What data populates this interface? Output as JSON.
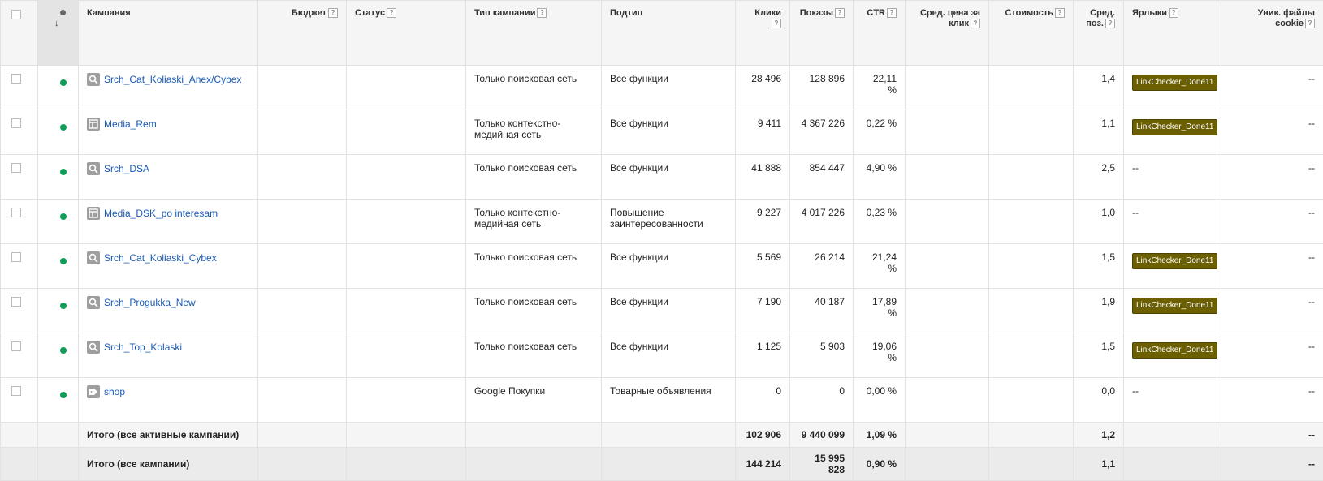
{
  "columns": {
    "campaign": "Кампания",
    "budget": "Бюджет",
    "status": "Статус",
    "type": "Тип кампании",
    "subtype": "Подтип",
    "clicks": "Клики",
    "impressions": "Показы",
    "ctr": "CTR",
    "avg_cpc": "Сред. цена за клик",
    "cost": "Стоимость",
    "avg_pos": "Сред. поз.",
    "labels": "Ярлыки",
    "unique_cookies": "Уник. файлы cookie"
  },
  "help_mark": "?",
  "sort_arrow": "↓",
  "rows": [
    {
      "icon": "search-icon",
      "name": "Srch_Cat_Koliaski_Anex/Cybex",
      "type": "Только поисковая сеть",
      "subtype": "Все функции",
      "clicks": "28 496",
      "impressions": "128 896",
      "ctr": "22,11 %",
      "avg_pos": "1,4",
      "label": "LinkChecker_Done11",
      "cookies": "--"
    },
    {
      "icon": "display-icon",
      "name": "Media_Rem",
      "type": "Только контекстно-медийная сеть",
      "subtype": "Все функции",
      "clicks": "9 411",
      "impressions": "4 367 226",
      "ctr": "0,22 %",
      "avg_pos": "1,1",
      "label": "LinkChecker_Done11",
      "cookies": "--"
    },
    {
      "icon": "search-icon",
      "name": "Srch_DSA",
      "type": "Только поисковая сеть",
      "subtype": "Все функции",
      "clicks": "41 888",
      "impressions": "854 447",
      "ctr": "4,90 %",
      "avg_pos": "2,5",
      "label": "--",
      "cookies": "--"
    },
    {
      "icon": "display-icon",
      "name": "Media_DSK_po interesam",
      "type": "Только контекстно-медийная сеть",
      "subtype": "Повышение заинтересованности",
      "clicks": "9 227",
      "impressions": "4 017 226",
      "ctr": "0,23 %",
      "avg_pos": "1,0",
      "label": "--",
      "cookies": "--"
    },
    {
      "icon": "search-icon",
      "name": "Srch_Cat_Koliaski_Cybex",
      "type": "Только поисковая сеть",
      "subtype": "Все функции",
      "clicks": "5 569",
      "impressions": "26 214",
      "ctr": "21,24 %",
      "avg_pos": "1,5",
      "label": "LinkChecker_Done11",
      "cookies": "--"
    },
    {
      "icon": "search-icon",
      "name": "Srch_Progukka_New",
      "type": "Только поисковая сеть",
      "subtype": "Все функции",
      "clicks": "7 190",
      "impressions": "40 187",
      "ctr": "17,89 %",
      "avg_pos": "1,9",
      "label": "LinkChecker_Done11",
      "cookies": "--"
    },
    {
      "icon": "search-icon",
      "name": "Srch_Top_Kolaski",
      "type": "Только поисковая сеть",
      "subtype": "Все функции",
      "clicks": "1 125",
      "impressions": "5 903",
      "ctr": "19,06 %",
      "avg_pos": "1,5",
      "label": "LinkChecker_Done11",
      "cookies": "--"
    },
    {
      "icon": "shopping-tag-icon",
      "name": "shop",
      "type": "Google Покупки",
      "subtype": "Товарные объявления",
      "clicks": "0",
      "impressions": "0",
      "ctr": "0,00 %",
      "avg_pos": "0,0",
      "label": "--",
      "cookies": "--"
    }
  ],
  "totals": [
    {
      "label": "Итого (все активные кампании)",
      "clicks": "102 906",
      "impressions": "9 440 099",
      "ctr": "1,09 %",
      "avg_pos": "1,2",
      "cookies": "--"
    },
    {
      "label": "Итого (все кампании)",
      "clicks": "144 214",
      "impressions": "15 995 828",
      "ctr": "0,90 %",
      "avg_pos": "1,1",
      "cookies": "--"
    }
  ]
}
